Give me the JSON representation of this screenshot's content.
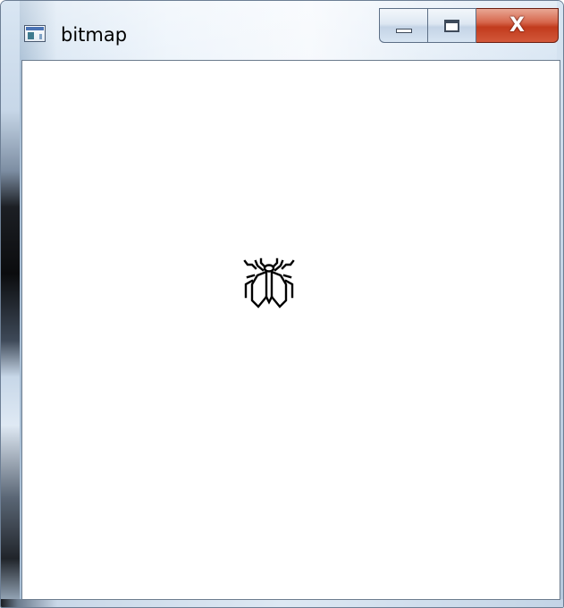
{
  "window": {
    "title": "bitmap",
    "icon": "application-window-icon",
    "buttons": {
      "minimize": "minimize-icon",
      "maximize": "maximize-icon",
      "close": "close-icon",
      "close_label": "X"
    }
  },
  "client": {
    "bitmap_icon": "bug-icon"
  }
}
